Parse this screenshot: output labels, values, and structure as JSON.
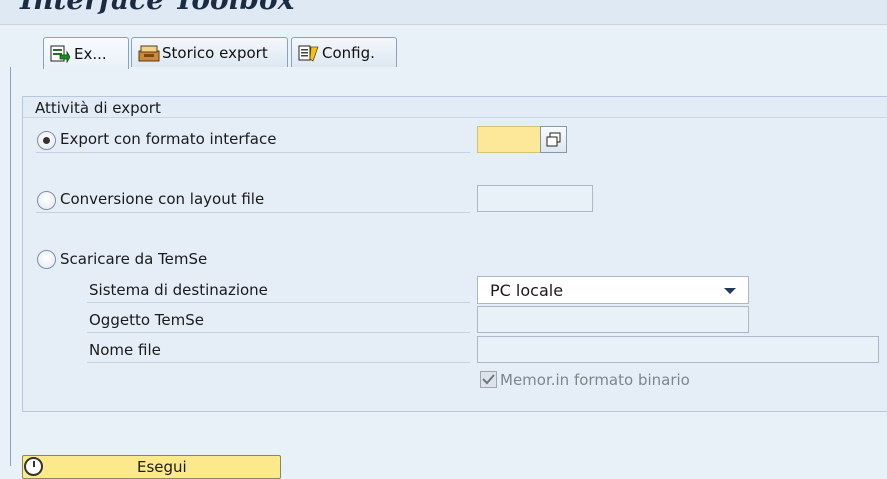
{
  "title": "Interface Toolbox",
  "tabs": [
    {
      "label": "Ex...",
      "icon": "export-icon",
      "active": true
    },
    {
      "label": "Storico export",
      "icon": "archive-icon",
      "active": false
    },
    {
      "label": "Config.",
      "icon": "config-icon",
      "active": false
    }
  ],
  "group": {
    "title": "Attività di export",
    "options": [
      {
        "label": "Export con formato interface",
        "selected": true
      },
      {
        "label": "Conversione con layout file",
        "selected": false
      },
      {
        "label": "Scaricare da TemSe",
        "selected": false
      }
    ],
    "temse": {
      "dest_label": "Sistema di destinazione",
      "dest_value": "PC locale",
      "object_label": "Oggetto TemSe",
      "object_value": "",
      "file_label": "Nome file",
      "file_value": "",
      "binary_label": "Memor.in formato binario",
      "binary_checked": true
    }
  },
  "execute_label": "Esegui",
  "colors": {
    "required_field": "#fde89a",
    "background": "#e8f1f8",
    "execute_button": "#fbe98b"
  }
}
